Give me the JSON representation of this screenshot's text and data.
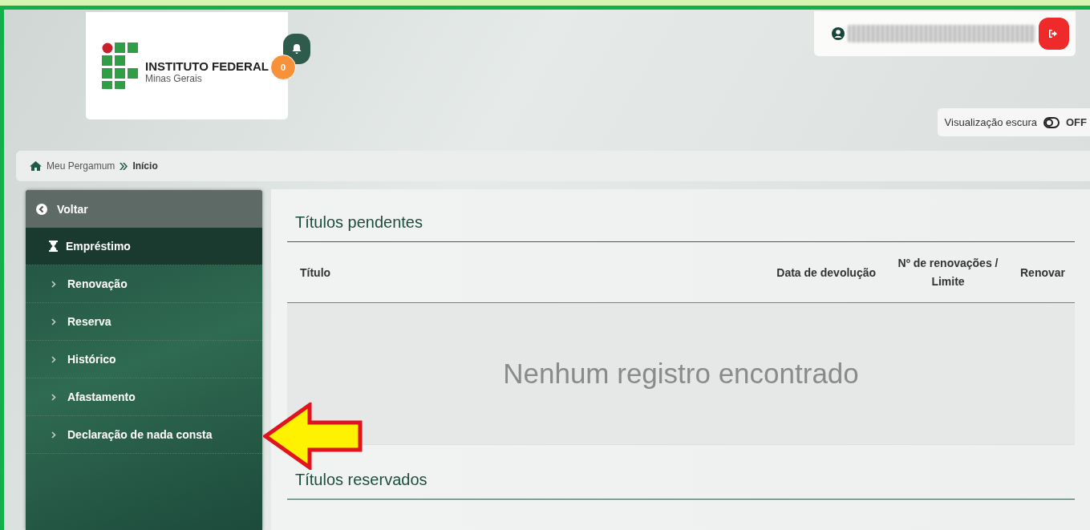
{
  "header": {
    "logo": {
      "title": "INSTITUTO FEDERAL",
      "subtitle": "Minas Gerais"
    },
    "notifications": {
      "count": "0"
    },
    "dark_mode": {
      "label": "Visualização escura",
      "on": false,
      "state": "OFF"
    }
  },
  "breadcrumb": [
    {
      "label": "Meu Pergamum"
    },
    {
      "label": "Início"
    }
  ],
  "sidebar": {
    "back_label": "Voltar",
    "items": [
      {
        "label": "Empréstimo",
        "selected": true
      },
      {
        "label": "Renovação",
        "selected": false
      },
      {
        "label": "Reserva",
        "selected": false
      },
      {
        "label": "Histórico",
        "selected": false
      },
      {
        "label": "Afastamento",
        "selected": false
      },
      {
        "label": "Declaração de nada consta",
        "selected": false
      }
    ]
  },
  "sections": [
    {
      "title": "Títulos pendentes",
      "columns": [
        "Título",
        "Data de devolução",
        "Nº de renovações / Limite",
        "Renovar"
      ],
      "empty_message": "Nenhum registro encontrado"
    },
    {
      "title": "Títulos reservados"
    }
  ]
}
